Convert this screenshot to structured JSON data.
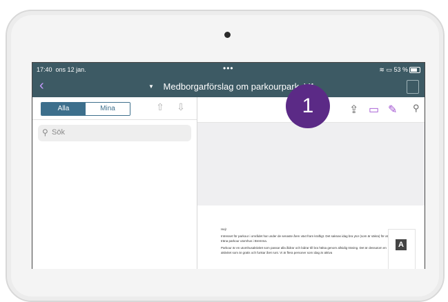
{
  "status": {
    "time": "17:40",
    "date": "ons 12 jan.",
    "dots": "•••",
    "battery_text": "53 %"
  },
  "nav": {
    "back": "‹",
    "title": "Medborgarförslag om parkourpark_V1"
  },
  "left": {
    "segment_active": "Alla",
    "segment_inactive": "Mina",
    "search_placeholder": "Sök"
  },
  "badge": {
    "number": "1"
  },
  "document": {
    "greeting": "Hej!",
    "p1": "Intresset för parkour i området har under de senaste åren växt fram kraftigt. Det saknas idag bra ytor (som är säkra) för att träna parkour utomhus i Bremma.",
    "p2": "Parkour är en utomhusaktivitet som passar alla åldrar och bidrar till bra hälsa genom allsidig träning. Det är dessutom en aktivitet som är gratis och funkar året runt. Vi är flera personer som idag är aktiva"
  },
  "side_tool": {
    "label": "A"
  },
  "colors": {
    "bar": "#3d5a64",
    "accent": "#c79bff",
    "badge": "#5b2a86",
    "segment": "#3d6f8c"
  }
}
